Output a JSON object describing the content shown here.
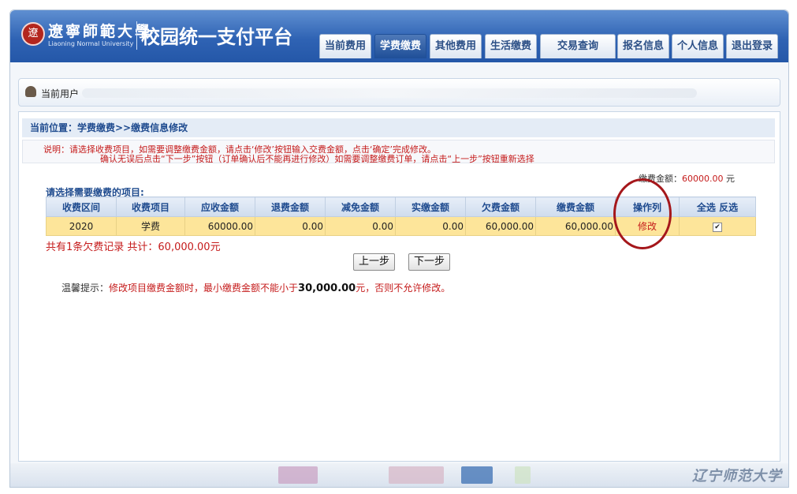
{
  "brand": {
    "logo_glyph": "遼",
    "university_cn": "遼寧師範大學",
    "university_en": "Liaoning Normal University",
    "platform_title": "校园统一支付平台"
  },
  "nav": {
    "tabs": [
      {
        "label": "当前费用"
      },
      {
        "label": "学费缴费",
        "active": true
      },
      {
        "label": "其他费用"
      },
      {
        "label": "生活缴费"
      },
      {
        "label": "交易查询"
      },
      {
        "label": "报名信息"
      },
      {
        "label": "个人信息"
      },
      {
        "label": "退出登录"
      }
    ]
  },
  "user_bar": {
    "label": "当前用户"
  },
  "location": {
    "text": "当前位置：学费缴费>>缴费信息修改"
  },
  "notice": {
    "line1": "说明：请选择收费项目，如需要调整缴费金额，请点击‘修改’按钮输入交费金额，点击‘确定’完成修改。",
    "line2": "确认无误后点击“下一步”按钮（订单确认后不能再进行修改）如需要调整缴费订单，请点击“上一步”按钮重新选择"
  },
  "pay_amount": {
    "label": "缴费金额：",
    "value": "60000.00",
    "unit": "元"
  },
  "select_title": "请选择需要缴费的项目:",
  "table": {
    "headers": [
      "收费区间",
      "收费项目",
      "应收金额",
      "退费金额",
      "减免金额",
      "实缴金额",
      "欠费金额",
      "缴费金额",
      "操作列",
      "全选  反选"
    ],
    "rows": [
      {
        "period": "2020",
        "item": "学费",
        "receivable": "60000.00",
        "refund": "0.00",
        "discount": "0.00",
        "paid": "0.00",
        "owed": "60,000.00",
        "payment": "60,000.00",
        "action": "修改",
        "checked": true
      }
    ]
  },
  "summary": "共有1条欠费记录  共计：60,000.00元",
  "buttons": {
    "prev": "上一步",
    "next": "下一步"
  },
  "tips": {
    "prefix": "温馨提示：",
    "red1": "修改项目缴费金额时，最小缴费金额不能小于",
    "amount": "30,000.00",
    "red2": "元，否则不允许修改。"
  },
  "footer": {
    "watermark": "辽宁师范大学"
  },
  "colors": {
    "header_blue": "#2f63b4",
    "accent_red": "#c51b1b",
    "row_yellow": "#fde59a"
  }
}
